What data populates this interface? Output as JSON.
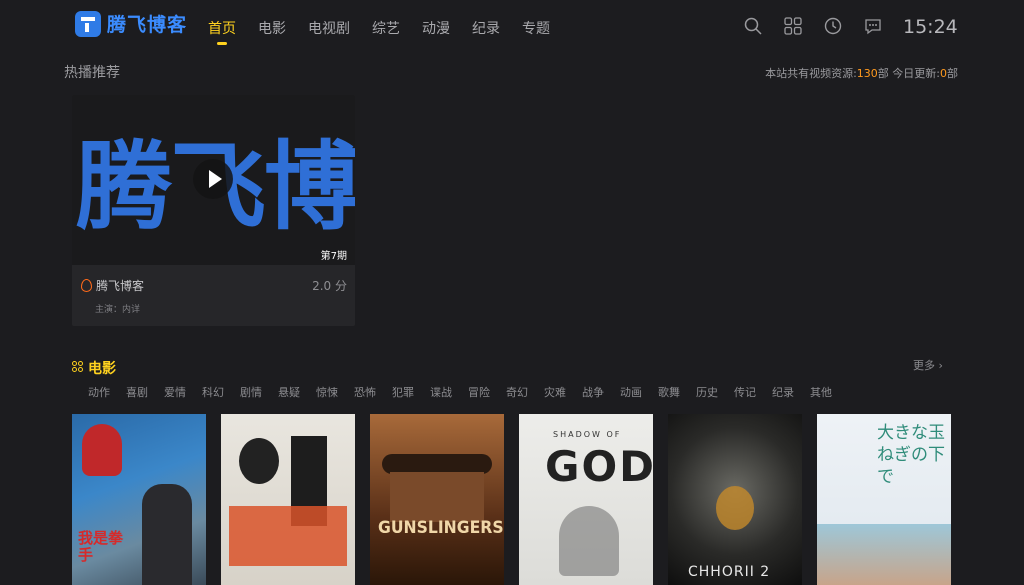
{
  "app": {
    "logo_text": "腾飞博客",
    "clock": "15:24"
  },
  "nav": [
    {
      "label": "首页",
      "active": true
    },
    {
      "label": "电影"
    },
    {
      "label": "电视剧"
    },
    {
      "label": "综艺"
    },
    {
      "label": "动漫"
    },
    {
      "label": "纪录"
    },
    {
      "label": "专题"
    }
  ],
  "top_icons": [
    "search-icon",
    "grid-icon",
    "history-icon",
    "message-icon"
  ],
  "hot": {
    "section_title": "热播推荐",
    "stats": {
      "prefix": "本站共有视频资源:",
      "total": "130",
      "unit1": "部 今日更新:",
      "today": "0",
      "unit2": "部"
    },
    "card": {
      "image_text": "腾飞博",
      "episode": "第7期",
      "title": "腾飞博客",
      "score": "2.0 分",
      "cast": "主演：内详"
    }
  },
  "movies": {
    "title": "电影",
    "more": "更多 ›",
    "genres": [
      "动作",
      "喜剧",
      "爱情",
      "科幻",
      "剧情",
      "悬疑",
      "惊悚",
      "恐怖",
      "犯罪",
      "谍战",
      "冒险",
      "奇幻",
      "灾难",
      "战争",
      "动画",
      "歌舞",
      "历史",
      "传记",
      "纪录",
      "其他"
    ],
    "posters": [
      {
        "text": "我是拳手"
      },
      {
        "text": ""
      },
      {
        "text": "GUNSLINGERS"
      },
      {
        "text": "GOD",
        "subtext": "SHADOW OF"
      },
      {
        "text": "CHHORII 2"
      },
      {
        "text": "大きな玉ねぎの下で"
      }
    ]
  },
  "colors": {
    "accent": "#ffd21f",
    "logo_blue": "#2f7be6",
    "highlight": "#ff9a1f",
    "background": "#1c1c1f"
  }
}
